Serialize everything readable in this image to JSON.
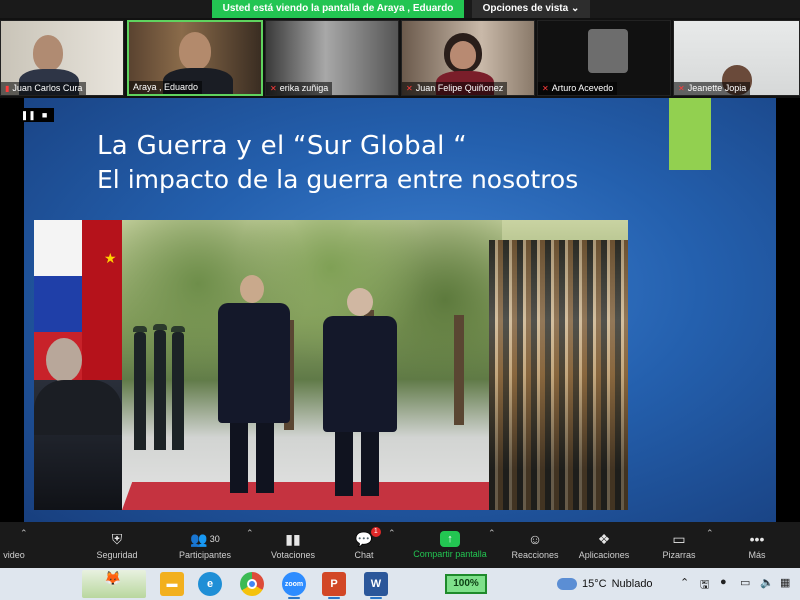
{
  "banner": {
    "share_notice": "Usted está viendo la pantalla de Araya , Eduardo",
    "view_options": "Opciones de vista"
  },
  "participants": [
    {
      "name": "Juan Carlos Cura",
      "muted": false
    },
    {
      "name": "Araya , Eduardo",
      "muted": false,
      "active": true
    },
    {
      "name": "erika zuñiga",
      "muted": true
    },
    {
      "name": "Juan Felipe Quiñonez",
      "muted": true
    },
    {
      "name": "Arturo Acevedo",
      "muted": true
    },
    {
      "name": "Jeanette Jopia",
      "muted": true
    }
  ],
  "slide": {
    "title": "La Guerra y el “Sur Global “",
    "subtitle": "El impacto de la guerra entre nosotros"
  },
  "toolbar": {
    "items": [
      {
        "id": "video",
        "label": "video",
        "icon": "video-icon"
      },
      {
        "id": "seguridad",
        "label": "Seguridad",
        "icon": "shield-icon"
      },
      {
        "id": "participantes",
        "label": "Participantes",
        "icon": "participants-icon",
        "count": "30"
      },
      {
        "id": "votaciones",
        "label": "Votaciones",
        "icon": "polls-icon"
      },
      {
        "id": "chat",
        "label": "Chat",
        "icon": "chat-icon",
        "badge": "1"
      },
      {
        "id": "compartir",
        "label": "Compartir pantalla",
        "icon": "share-screen-icon"
      },
      {
        "id": "reacciones",
        "label": "Reacciones",
        "icon": "reactions-icon"
      },
      {
        "id": "aplicaciones",
        "label": "Aplicaciones",
        "icon": "apps-icon"
      },
      {
        "id": "pizarras",
        "label": "Pizarras",
        "icon": "whiteboard-icon"
      },
      {
        "id": "mas",
        "label": "Más",
        "icon": "more-icon"
      }
    ]
  },
  "taskbar": {
    "zoom_level": "100%",
    "weather_temp": "15°C",
    "weather_desc": "Nublado",
    "apps": [
      {
        "name": "file-explorer-icon",
        "color": "#f2b01e"
      },
      {
        "name": "edge-icon",
        "color": "#1f8fd6"
      },
      {
        "name": "chrome-icon",
        "color": "#dd4b39"
      },
      {
        "name": "zoom-icon",
        "color": "#2d8cff",
        "glyph": "zoom"
      },
      {
        "name": "powerpoint-icon",
        "color": "#d24726",
        "glyph": "P"
      },
      {
        "name": "word-icon",
        "color": "#2b579a",
        "glyph": "W"
      }
    ]
  },
  "colors": {
    "share_green": "#23c552",
    "slide_accent": "#92d050",
    "slide_blue": "#2460ae"
  }
}
